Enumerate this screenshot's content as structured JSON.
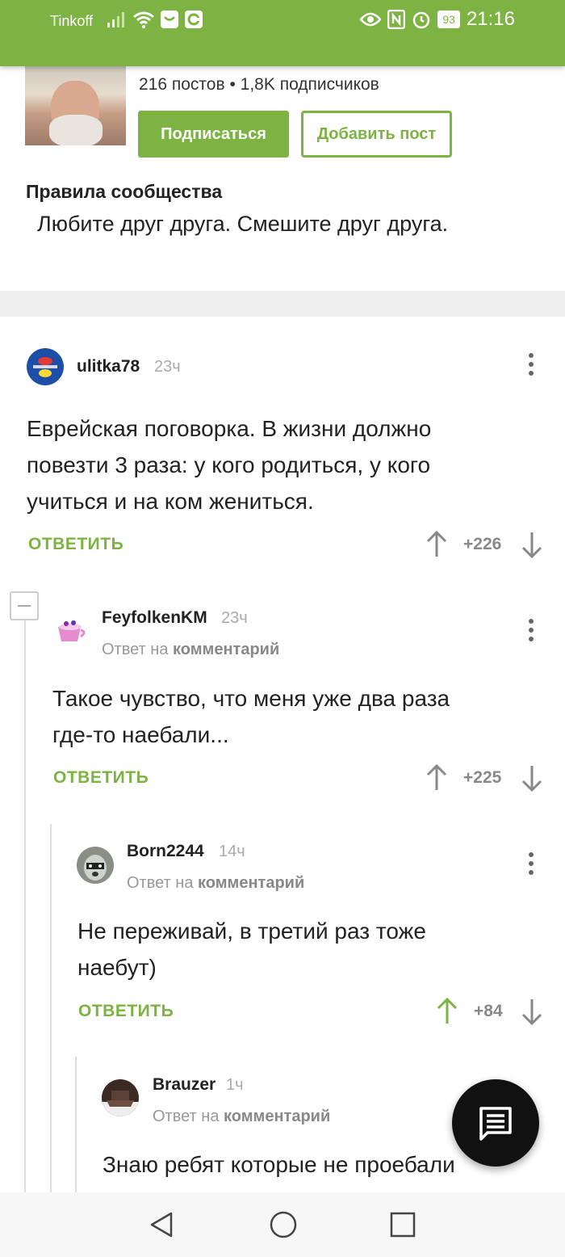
{
  "status_bar": {
    "carrier": "Tinkoff",
    "battery": "93",
    "time": "21:16"
  },
  "community": {
    "stats": "216 постов • 1,8K подписчиков",
    "subscribe_label": "Подписаться",
    "add_post_label": "Добавить пост",
    "rules_title": "Правила сообщества",
    "rules_text": "Любите друг друга. Смешите друг друга."
  },
  "comments": [
    {
      "user": "ulitka78",
      "time": "23ч",
      "text_lines": [
        "Еврейская поговорка. В жизни должно",
        "повезти 3 раза: у кого родиться, у кого",
        "учиться и на ком жениться."
      ],
      "reply_label": "ОТВЕТИТЬ",
      "score": "+226",
      "upvoted": false
    },
    {
      "user": "FeyfolkenKM",
      "time": "23ч",
      "reply_to_prefix": "Ответ на",
      "reply_to_link": "комментарий",
      "text_lines": [
        "Такое чувство, что меня уже два раза",
        "где-то наебали..."
      ],
      "reply_label": "ОТВЕТИТЬ",
      "score": "+225",
      "upvoted": false
    },
    {
      "user": "Born2244",
      "time": "14ч",
      "reply_to_prefix": "Ответ на",
      "reply_to_link": "комментарий",
      "text_lines": [
        "Не переживай, в третий раз тоже",
        "наебут)"
      ],
      "reply_label": "ОТВЕТИТЬ",
      "score": "+84",
      "upvoted": true
    },
    {
      "user": "Brauzer",
      "time": "1ч",
      "reply_to_prefix": "Ответ на",
      "reply_to_link": "комментарий",
      "text_lines": [
        "Знаю ребят которые не проебали"
      ]
    }
  ],
  "colors": {
    "accent": "#7cb342",
    "text": "#222222",
    "muted": "#999999"
  }
}
